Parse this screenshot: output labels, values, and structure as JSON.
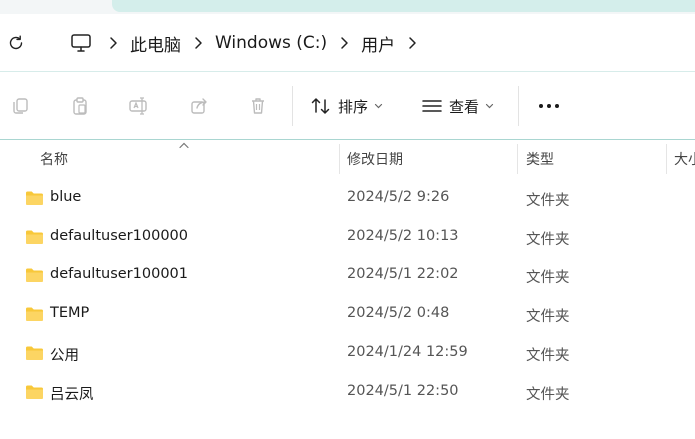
{
  "address_bar": {
    "breadcrumbs": [
      "此电脑",
      "Windows (C:)",
      "用户"
    ]
  },
  "toolbar": {
    "sort_label": "排序",
    "view_label": "查看"
  },
  "columns": {
    "name": "名称",
    "modified": "修改日期",
    "type": "类型",
    "size": "大小"
  },
  "files": [
    {
      "name": "blue",
      "modified": "2024/5/2 9:26",
      "type": "文件夹"
    },
    {
      "name": "defaultuser100000",
      "modified": "2024/5/2 10:13",
      "type": "文件夹"
    },
    {
      "name": "defaultuser100001",
      "modified": "2024/5/1 22:02",
      "type": "文件夹"
    },
    {
      "name": "TEMP",
      "modified": "2024/5/2 0:48",
      "type": "文件夹"
    },
    {
      "name": "公用",
      "modified": "2024/1/24 12:59",
      "type": "文件夹"
    },
    {
      "name": "吕云凤",
      "modified": "2024/5/1 22:50",
      "type": "文件夹"
    }
  ],
  "colors": {
    "accent_strip": "#d4eeeb",
    "toolbar_border": "#a9d6d1",
    "folder_yellow": "#f8c83a"
  }
}
